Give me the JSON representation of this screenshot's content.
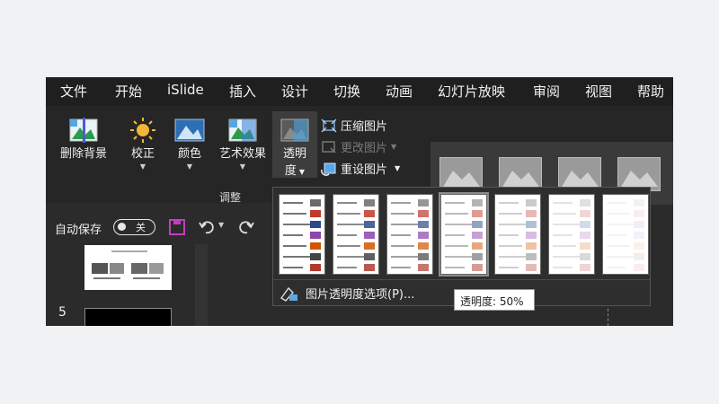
{
  "tabs": [
    "文件",
    "开始",
    "iSlide",
    "插入",
    "设计",
    "切换",
    "动画",
    "幻灯片放映",
    "审阅",
    "视图",
    "帮助"
  ],
  "ribbon": {
    "remove_bg": "删除背景",
    "correct": "校正",
    "color": "颜色",
    "art_effect": "艺术效果",
    "transparency_l1": "透明",
    "transparency_l2": "度",
    "compress": "压缩图片",
    "change": "更改图片",
    "reset": "重设图片",
    "group_label": "调整"
  },
  "qat": {
    "autosave": "自动保存",
    "toggle_state": "关"
  },
  "slide_pane": {
    "slide_number": "5"
  },
  "dropdown": {
    "menu_item": "图片透明度选项(P)...",
    "selected_index": 3,
    "options_opacity": [
      1.0,
      0.85,
      0.7,
      0.5,
      0.35,
      0.2,
      0.08
    ]
  },
  "tooltip": "透明度: 50%",
  "colors": {
    "tab_bg": "#1f1f1f",
    "ribbon_bg": "#262626",
    "accent_save": "#c03fbd"
  }
}
